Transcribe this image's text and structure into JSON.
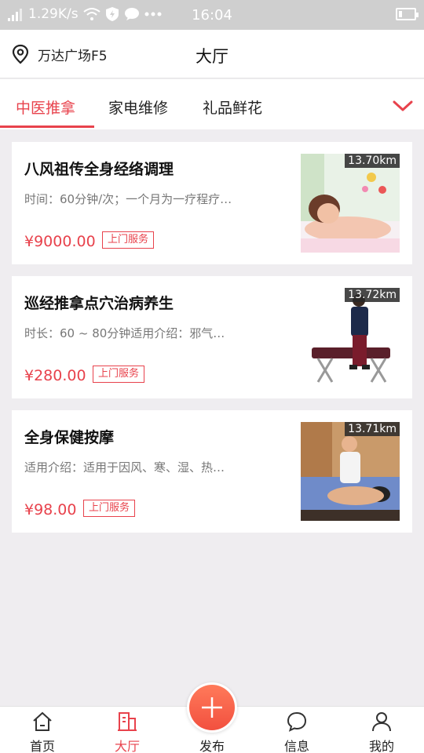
{
  "status_bar": {
    "network_speed": "1.29K/s",
    "time": "16:04"
  },
  "header": {
    "location": "万达广场F5",
    "title": "大厅"
  },
  "category_tabs": [
    "中医推拿",
    "家电维修",
    "礼品鲜花"
  ],
  "items": [
    {
      "name": "八风祖传全身经络调理",
      "desc": "时间：60分钟/次；一个月为一疗程疗…",
      "price": "¥9000.00",
      "tag": "上门服务",
      "distance": "13.70km"
    },
    {
      "name": "巡经推拿点穴治病养生",
      "desc": "时长：60 ~ 80分钟适用介绍：邪气…",
      "price": "¥280.00",
      "tag": "上门服务",
      "distance": "13.72km"
    },
    {
      "name": "全身保健按摩",
      "desc": "适用介绍：适用于因风、寒、湿、热…",
      "price": "¥98.00",
      "tag": "上门服务",
      "distance": "13.71km"
    }
  ],
  "bottom_nav": [
    "首页",
    "大厅",
    "发布",
    "信息",
    "我的"
  ],
  "colors": {
    "accent": "#e8424c",
    "background": "#efedf0",
    "fab": "#f2503f"
  }
}
